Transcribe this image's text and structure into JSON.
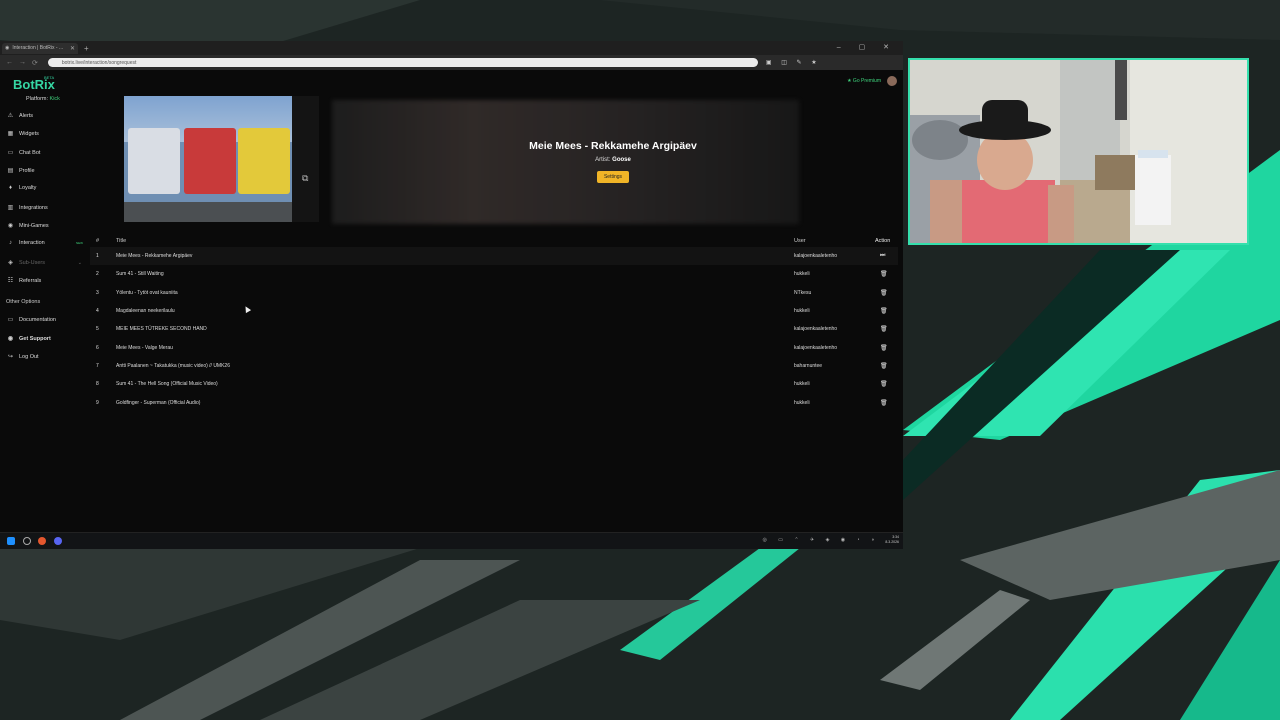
{
  "browser": {
    "tab_title": "Interaction | BotRix - ...",
    "new_tab": "+",
    "window_controls": "– ▢ ✕",
    "url": "botrix.live/interaction/songrequest",
    "nav": {
      "back": "←",
      "forward": "→",
      "reload": "⟳"
    },
    "extension_icons": "▣ ◫ ✎ ★"
  },
  "app": {
    "logo": "BotRix",
    "logo_badge": "BETA",
    "platform_label": "Platform:",
    "platform_value": "Kick",
    "go_premium": "★ Go Premium",
    "sidebar": {
      "items": [
        {
          "label": "Alerts",
          "icon": "⚠"
        },
        {
          "label": "Widgets",
          "icon": "▦"
        },
        {
          "label": "Chat Bot",
          "icon": "▭"
        },
        {
          "label": "Profile",
          "icon": "▤"
        },
        {
          "label": "Loyalty",
          "icon": "♦"
        },
        {
          "label": "Integrations",
          "icon": "▥"
        },
        {
          "label": "Mini-Games",
          "icon": "◉"
        },
        {
          "label": "Interaction",
          "icon": "♪",
          "badge": "NEW"
        },
        {
          "label": "Sub-Users",
          "icon": "◈"
        },
        {
          "label": "Referrals",
          "icon": "☷"
        }
      ],
      "other_options_label": "Other Options",
      "other_items": [
        {
          "label": "Documentation",
          "icon": "▭"
        },
        {
          "label": "Get Support",
          "icon": "◉"
        },
        {
          "label": "Log Out",
          "icon": "↪"
        }
      ]
    },
    "now_playing": {
      "title": "Meie Mees - Rekkamehe Argipäev",
      "artist_label": "Artist:",
      "artist": "Goose",
      "settings_button": "Settings"
    },
    "queue": {
      "headers": {
        "num": "#",
        "title": "Title",
        "user": "User",
        "action": "Action"
      },
      "rows": [
        {
          "num": "1",
          "title": "Meie Mees - Rekkamehe Argipäev",
          "user": "kalajoenkaaletenho",
          "action": "⏭"
        },
        {
          "num": "2",
          "title": "Sum 41 - Still Waiting",
          "user": "hukkeli",
          "action": "🗑"
        },
        {
          "num": "3",
          "title": "Yölentu - Tytöt ovat kauniita",
          "user": "NTkesu",
          "action": "🗑"
        },
        {
          "num": "4",
          "title": "Magdaleenan neekerilaulu",
          "user": "hukkeli",
          "action": "🗑"
        },
        {
          "num": "5",
          "title": "MEIE MEES TÜTREKE SECOND HAND",
          "user": "kalajoenkaaletenho",
          "action": "🗑"
        },
        {
          "num": "6",
          "title": "Meie Mees - Valge Merau",
          "user": "kalajoenkaaletenho",
          "action": "🗑"
        },
        {
          "num": "7",
          "title": "Antti Paalanen ~ Takatukka (music video) // UMK26",
          "user": "baharnuntee",
          "action": "🗑"
        },
        {
          "num": "8",
          "title": "Sum 41 - The Hell Song (Official Music Video)",
          "user": "hukkeli",
          "action": "🗑"
        },
        {
          "num": "9",
          "title": "Goldfinger - Superman (Official Audio)",
          "user": "hukkeli",
          "action": "🗑"
        }
      ]
    }
  },
  "taskbar": {
    "tray_icons": "◎ ▭ ⌃ ✈ ◈ ◉ ◔ ◑",
    "time": "3:34",
    "date": "8.3.2026"
  },
  "colors": {
    "accent": "#35d6a3",
    "kick_green": "#3ed27c",
    "settings_yellow": "#f0b427",
    "webcam_border": "#35e0ad"
  }
}
